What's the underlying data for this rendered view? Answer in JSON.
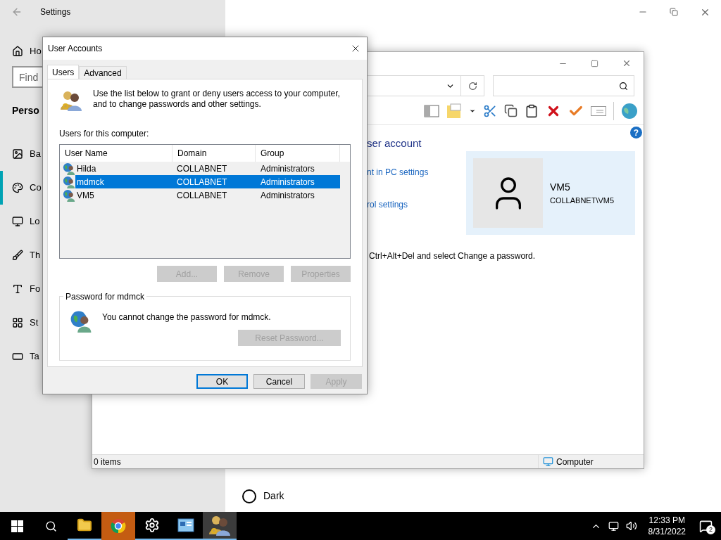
{
  "settings": {
    "title": "Settings",
    "home": "Ho",
    "search": {
      "placeholder": "Find"
    },
    "section": "Perso",
    "items": [
      {
        "label": "Ba",
        "selected": false
      },
      {
        "label": "Co",
        "selected": true
      },
      {
        "label": "Lo",
        "selected": false
      },
      {
        "label": "Th",
        "selected": false
      },
      {
        "label": "Fo",
        "selected": false
      },
      {
        "label": "St",
        "selected": false
      },
      {
        "label": "Ta",
        "selected": false
      }
    ],
    "theme_options": [
      {
        "label": "Dark",
        "selected": false
      }
    ]
  },
  "explorer": {
    "heading": "ser account",
    "links": [
      "nt in PC settings",
      "rol settings"
    ],
    "user_card": {
      "name": "VM5",
      "account": "COLLABNET\\VM5"
    },
    "help": "?",
    "note": "Ctrl+Alt+Del and select Change a password.",
    "status_bar": {
      "count": "0 items",
      "zone": "Computer"
    }
  },
  "dialog": {
    "title": "User Accounts",
    "tabs": [
      {
        "label": "Users",
        "selected": true
      },
      {
        "label": "Advanced",
        "selected": false
      }
    ],
    "intro": "Use the list below to grant or deny users access to your computer, and to change passwords and other settings.",
    "list_label": "Users for this computer:",
    "columns": [
      "User Name",
      "Domain",
      "Group"
    ],
    "rows": [
      {
        "cells": [
          "Hilda",
          "COLLABNET",
          "Administrators"
        ],
        "selected": false
      },
      {
        "cells": [
          "mdmck",
          "COLLABNET",
          "Administrators"
        ],
        "selected": true
      },
      {
        "cells": [
          "VM5",
          "COLLABNET",
          "Administrators"
        ],
        "selected": false
      }
    ],
    "list_buttons": [
      {
        "label": "Add...",
        "disabled": true
      },
      {
        "label": "Remove",
        "disabled": true
      },
      {
        "label": "Properties",
        "disabled": true
      }
    ],
    "password_group": {
      "title": "Password for mdmck",
      "message": "You cannot change the password for mdmck.",
      "button": {
        "label": "Reset Password...",
        "disabled": true
      }
    },
    "footer_buttons": [
      {
        "label": "OK",
        "disabled": false,
        "default": true
      },
      {
        "label": "Cancel",
        "disabled": false,
        "default": false
      },
      {
        "label": "Apply",
        "disabled": true,
        "default": false
      }
    ]
  },
  "taskbar": {
    "apps": [
      {
        "open": true,
        "active": false,
        "attention": false
      },
      {
        "open": false,
        "active": false,
        "attention": true
      },
      {
        "open": true,
        "active": false,
        "attention": false
      },
      {
        "open": true,
        "active": false,
        "attention": false
      },
      {
        "open": true,
        "active": true,
        "attention": false
      }
    ],
    "time": "12:33 PM",
    "date": "8/31/2022",
    "notifications": "2"
  }
}
